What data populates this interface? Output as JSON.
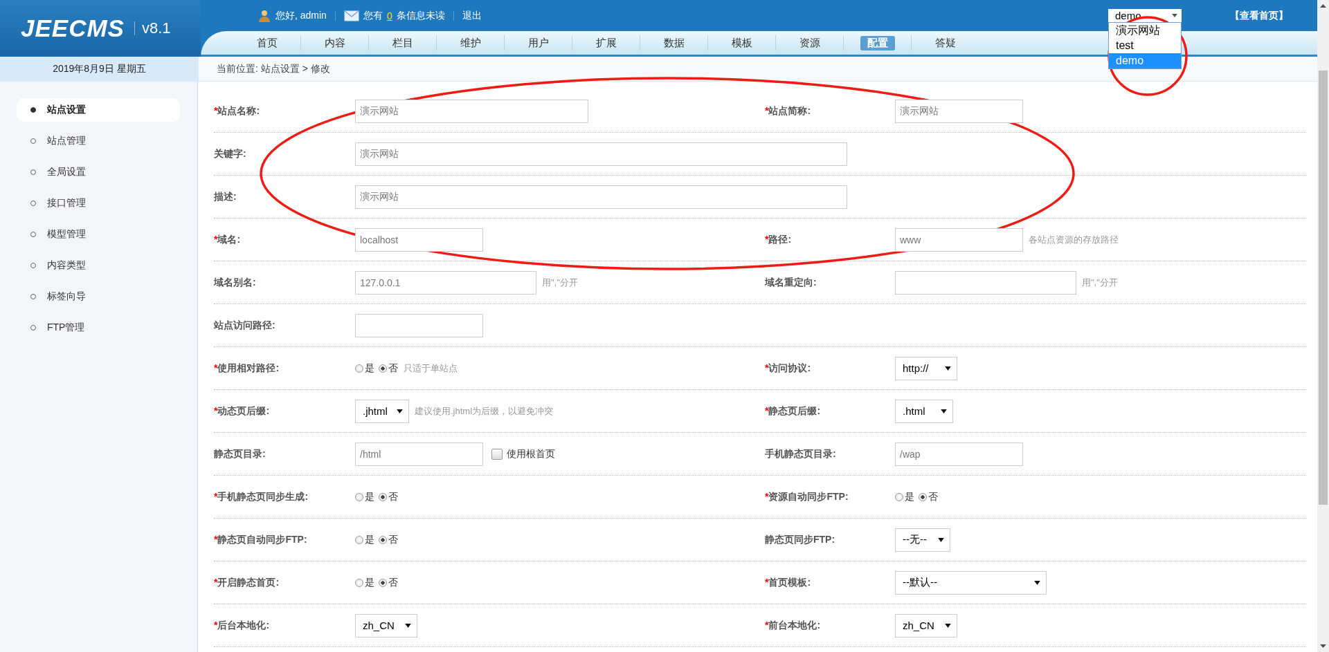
{
  "logo": {
    "name": "JEECMS",
    "version": "v8.1"
  },
  "user_bar": {
    "greeting": "您好, admin",
    "messages_before": "您有",
    "messages_count": "0",
    "messages_after": "条信息未读",
    "logout": "退出"
  },
  "site_switcher": {
    "value": "demo",
    "expanded": true,
    "options": [
      {
        "label": "演示网站",
        "selected": false
      },
      {
        "label": "test",
        "selected": false
      },
      {
        "label": "demo",
        "selected": true
      }
    ]
  },
  "home_link": "【查看首页】",
  "nav_tabs": [
    {
      "label": "首页",
      "selected": false
    },
    {
      "label": "内容",
      "selected": false
    },
    {
      "label": "栏目",
      "selected": false
    },
    {
      "label": "维护",
      "selected": false
    },
    {
      "label": "用户",
      "selected": false
    },
    {
      "label": "扩展",
      "selected": false
    },
    {
      "label": "数据",
      "selected": false
    },
    {
      "label": "模板",
      "selected": false
    },
    {
      "label": "资源",
      "selected": false
    },
    {
      "label": "配置",
      "selected": true
    },
    {
      "label": "答疑",
      "selected": false
    }
  ],
  "date": "2019年8月9日 星期五",
  "breadcrumb": "当前位置: 站点设置 > 修改",
  "sidebar": {
    "items": [
      {
        "label": "站点设置",
        "selected": true
      },
      {
        "label": "站点管理",
        "selected": false
      },
      {
        "label": "全局设置",
        "selected": false
      },
      {
        "label": "接口管理",
        "selected": false
      },
      {
        "label": "模型管理",
        "selected": false
      },
      {
        "label": "内容类型",
        "selected": false
      },
      {
        "label": "标签向导",
        "selected": false
      },
      {
        "label": "FTP管理",
        "selected": false
      }
    ]
  },
  "form": {
    "rows": [
      {
        "fields": [
          {
            "required_mark": "*",
            "label": "站点名称:",
            "kind": "text",
            "value": "演示网站"
          },
          {
            "required_mark": "*",
            "label": "站点简称:",
            "kind": "text",
            "value": "演示网站"
          }
        ]
      },
      {
        "fields": [
          {
            "label": "关键字:",
            "kind": "text",
            "value": "演示网站"
          }
        ]
      },
      {
        "fields": [
          {
            "label": "描述:",
            "kind": "text",
            "value": "演示网站"
          }
        ]
      },
      {
        "fields": [
          {
            "required_mark": "*",
            "label": "域名:",
            "kind": "text",
            "value": "localhost"
          },
          {
            "required_mark": "*",
            "label": "路径:",
            "kind": "text",
            "value": "www",
            "hint": "各站点资源的存放路径"
          }
        ]
      },
      {
        "fields": [
          {
            "label": "域名别名:",
            "kind": "text",
            "value": "127.0.0.1",
            "hint": "用\",\"分开"
          },
          {
            "label": "域名重定向:",
            "kind": "text",
            "hint": "用\",\"分开"
          }
        ]
      },
      {
        "fields": [
          {
            "label": "站点访问路径:",
            "kind": "text"
          }
        ]
      },
      {
        "fields": [
          {
            "required_mark": "*",
            "label": "使用相对路径:",
            "kind": "radio",
            "options": [
              {
                "label": "是",
                "selected": false
              },
              {
                "label": "否",
                "selected": true
              }
            ],
            "hint": "只适于单站点"
          },
          {
            "required_mark": "*",
            "label": "访问协议:",
            "kind": "select",
            "value": "http://"
          }
        ]
      },
      {
        "fields": [
          {
            "required_mark": "*",
            "label": "动态页后缀:",
            "kind": "select",
            "value": ".jhtml",
            "hint": "建议使用.jhtml为后缀，以避免冲突"
          },
          {
            "required_mark": "*",
            "label": "静态页后缀:",
            "kind": "select",
            "value": ".html"
          }
        ]
      },
      {
        "fields": [
          {
            "label": "静态页目录:",
            "kind": "text",
            "value": "/html",
            "checkbox": {
              "label": "使用根首页",
              "checked": false
            }
          },
          {
            "label": "手机静态页目录:",
            "kind": "text",
            "value": "/wap"
          }
        ]
      },
      {
        "fields": [
          {
            "required_mark": "*",
            "label": "手机静态页同步生成:",
            "kind": "radio",
            "options": [
              {
                "label": "是",
                "selected": false
              },
              {
                "label": "否",
                "selected": true
              }
            ]
          },
          {
            "required_mark": "*",
            "label": "资源自动同步FTP:",
            "kind": "radio",
            "options": [
              {
                "label": "是",
                "selected": false
              },
              {
                "label": "否",
                "selected": true
              }
            ]
          }
        ]
      },
      {
        "fields": [
          {
            "required_mark": "*",
            "label": "静态页自动同步FTP:",
            "kind": "radio",
            "options": [
              {
                "label": "是",
                "selected": false
              },
              {
                "label": "否",
                "selected": true
              }
            ]
          },
          {
            "label": "静态页同步FTP:",
            "kind": "select",
            "value": "--无--"
          }
        ]
      },
      {
        "fields": [
          {
            "required_mark": "*",
            "label": "开启静态首页:",
            "kind": "radio",
            "options": [
              {
                "label": "是",
                "selected": false
              },
              {
                "label": "否",
                "selected": true
              }
            ]
          },
          {
            "required_mark": "*",
            "label": "首页模板:",
            "kind": "select",
            "value": "--默认--"
          }
        ]
      },
      {
        "fields": [
          {
            "required_mark": "*",
            "label": "后台本地化:",
            "kind": "select",
            "value": "zh_CN"
          },
          {
            "required_mark": "*",
            "label": "前台本地化:",
            "kind": "select",
            "value": "zh_CN"
          }
        ]
      }
    ]
  },
  "annotations": [
    {
      "kind": "oval"
    },
    {
      "kind": "circle"
    }
  ]
}
